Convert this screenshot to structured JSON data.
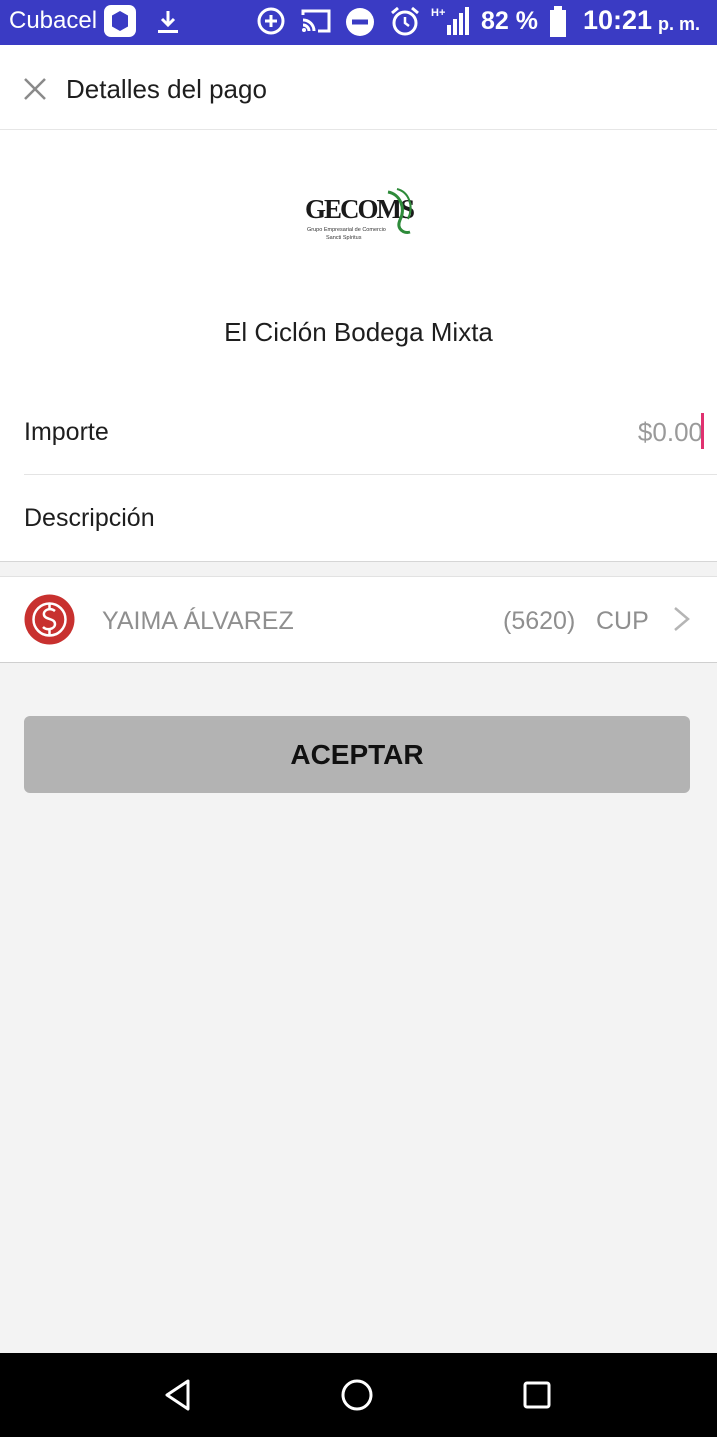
{
  "status_bar": {
    "carrier": "Cubacel",
    "battery_percent": "82 %",
    "time": "10:21",
    "time_suffix": "p. m.",
    "network_label": "H+",
    "color": "#3a3bc4"
  },
  "header": {
    "title": "Detalles del pago",
    "close_icon": "close-icon"
  },
  "merchant": {
    "logo_text": "GECOMSS",
    "logo_subtitle_1": "Grupo Empresarial de Comercio",
    "logo_subtitle_2": "Sancti Spíritus",
    "name": "El Ciclón Bodega Mixta"
  },
  "form": {
    "amount_label": "Importe",
    "amount_value": "$0.00",
    "description_label": "Descripción"
  },
  "account": {
    "holder": "YAIMA ÁLVAREZ",
    "card": "(5620)",
    "currency": "CUP",
    "bank_icon": "bank-logo-icon",
    "bank_color": "#c8312f"
  },
  "actions": {
    "accept_label": "ACEPTAR"
  },
  "nav_bar": {
    "back_icon": "back-triangle-icon",
    "home_icon": "home-circle-icon",
    "recents_icon": "recents-square-icon"
  }
}
